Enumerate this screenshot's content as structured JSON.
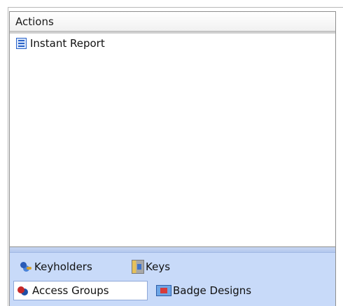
{
  "panel": {
    "header": "Actions",
    "items": [
      {
        "label": "Instant Report",
        "icon": "report-icon"
      }
    ]
  },
  "nav": {
    "items": [
      {
        "label": "Keyholders",
        "icon": "keyholders-icon",
        "selected": false
      },
      {
        "label": "Keys",
        "icon": "keys-icon",
        "selected": false
      },
      {
        "label": "Access Groups",
        "icon": "access-groups-icon",
        "selected": true
      },
      {
        "label": "Badge Designs",
        "icon": "badge-designs-icon",
        "selected": false
      }
    ]
  },
  "colors": {
    "nav_background": "#c8daf9",
    "selected_background": "#ffffff"
  }
}
